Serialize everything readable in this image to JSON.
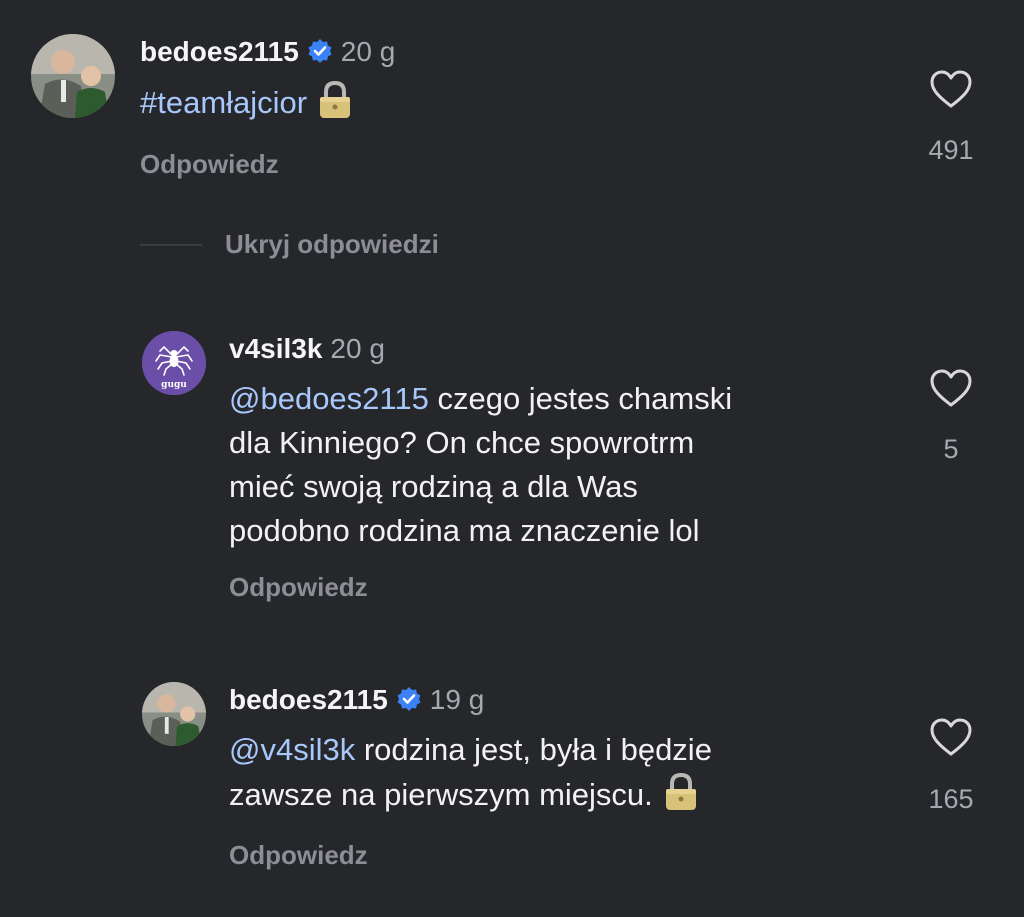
{
  "comments": [
    {
      "username": "bedoes2115",
      "verified": true,
      "time": "20 g",
      "text_parts": [
        "#teamłajcior"
      ],
      "reply_label": "Odpowiedz",
      "likes": "491",
      "avatar_icon": "photo-avatar-icon"
    },
    {
      "username": "v4sil3k",
      "verified": false,
      "time": "20 g",
      "mention": "@bedoes2115",
      "lines": [
        " czego jestes chamski",
        "dla Kinniego? On chce spowrotrm",
        "mieć swoją rodziną a dla Was",
        "podobno rodzina ma znaczenie lol"
      ],
      "reply_label": "Odpowiedz",
      "likes": "5",
      "avatar_label": "gugu",
      "avatar_icon": "spider-icon"
    },
    {
      "username": "bedoes2115",
      "verified": true,
      "time": "19 g",
      "mention": "@v4sil3k",
      "lines": [
        " rodzina jest, była i będzie",
        "zawsze na pierwszym miejscu."
      ],
      "reply_label": "Odpowiedz",
      "likes": "165",
      "avatar_icon": "photo-avatar-icon"
    }
  ],
  "hide_replies_label": "Ukryj odpowiedzi",
  "colors": {
    "background": "#26272b",
    "link": "#a8c7fa",
    "secondary": "#8d8d95",
    "verified": "#3b82f6",
    "avatar_purple": "#6a4ea8"
  }
}
